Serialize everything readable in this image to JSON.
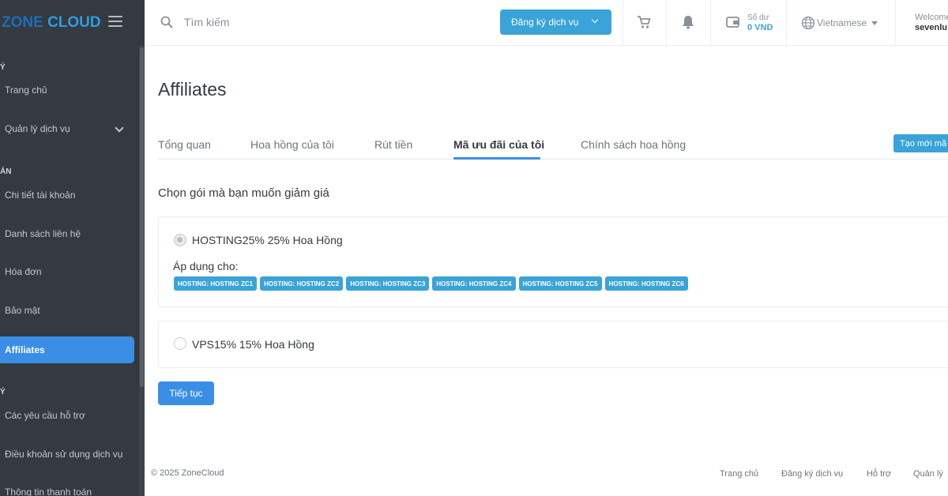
{
  "brand": {
    "part1": "ZONE",
    "part2": "CLOUD"
  },
  "sidebar": {
    "sections": [
      "Ý",
      "ẢN",
      "Ý"
    ],
    "items": [
      {
        "label": "Trang chủ"
      },
      {
        "label": "Quản lý dịch vụ"
      },
      {
        "label": "Chi tiết tài khoản"
      },
      {
        "label": "Danh sách liên hệ"
      },
      {
        "label": "Hóa đơn"
      },
      {
        "label": "Bảo mật"
      },
      {
        "label": "Affiliates"
      },
      {
        "label": "Các yêu cầu hỗ trợ"
      },
      {
        "label": "Điều khoản sử dụng dịch vụ"
      },
      {
        "label": "Thông tin thanh toán"
      }
    ]
  },
  "header": {
    "search_placeholder": "Tìm kiếm",
    "order_label": "Đăng ký dịch vụ",
    "balance_label": "Số dư",
    "balance_value": "0 VND",
    "language": "Vietnamese",
    "welcome": "Welcome",
    "username": "sevenlu"
  },
  "page": {
    "title": "Affiliates",
    "tabs": [
      {
        "label": "Tổng quan"
      },
      {
        "label": "Hoa hồng của tôi"
      },
      {
        "label": "Rút tiền"
      },
      {
        "label": "Mã ưu đãi của tôi"
      },
      {
        "label": "Chính sách hoa hồng"
      }
    ],
    "create_button": "Tạo mới mã",
    "prompt": "Chọn gói mà bạn muốn giảm giá",
    "plans": [
      {
        "label": "HOSTING25% 25% Hoa Hồng",
        "applies_label": "Áp dụng cho:",
        "applies_to": [
          "HOSTING: HOSTING ZC1",
          "HOSTING: HOSTING ZC2",
          "HOSTING: HOSTING ZC3",
          "HOSTING: HOSTING ZC4",
          "HOSTING: HOSTING ZC5",
          "HOSTING: HOSTING ZC6"
        ]
      },
      {
        "label": "VPS15% 15% Hoa Hồng"
      }
    ],
    "continue_button": "Tiếp tục"
  },
  "footer": {
    "copyright": "© 2025 ZoneCloud",
    "links": [
      "Trang chủ",
      "Đăng ký dịch vụ",
      "Hỗ trợ",
      "Quản lý"
    ]
  },
  "colors": {
    "accent": "#3a8ee6",
    "badge": "#3aa3d8",
    "sidebar_bg": "#343a40"
  },
  "icons": [
    "search-icon",
    "cart-icon",
    "bell-icon",
    "wallet-icon",
    "globe-icon",
    "menu-icon",
    "chevron-down-icon"
  ]
}
